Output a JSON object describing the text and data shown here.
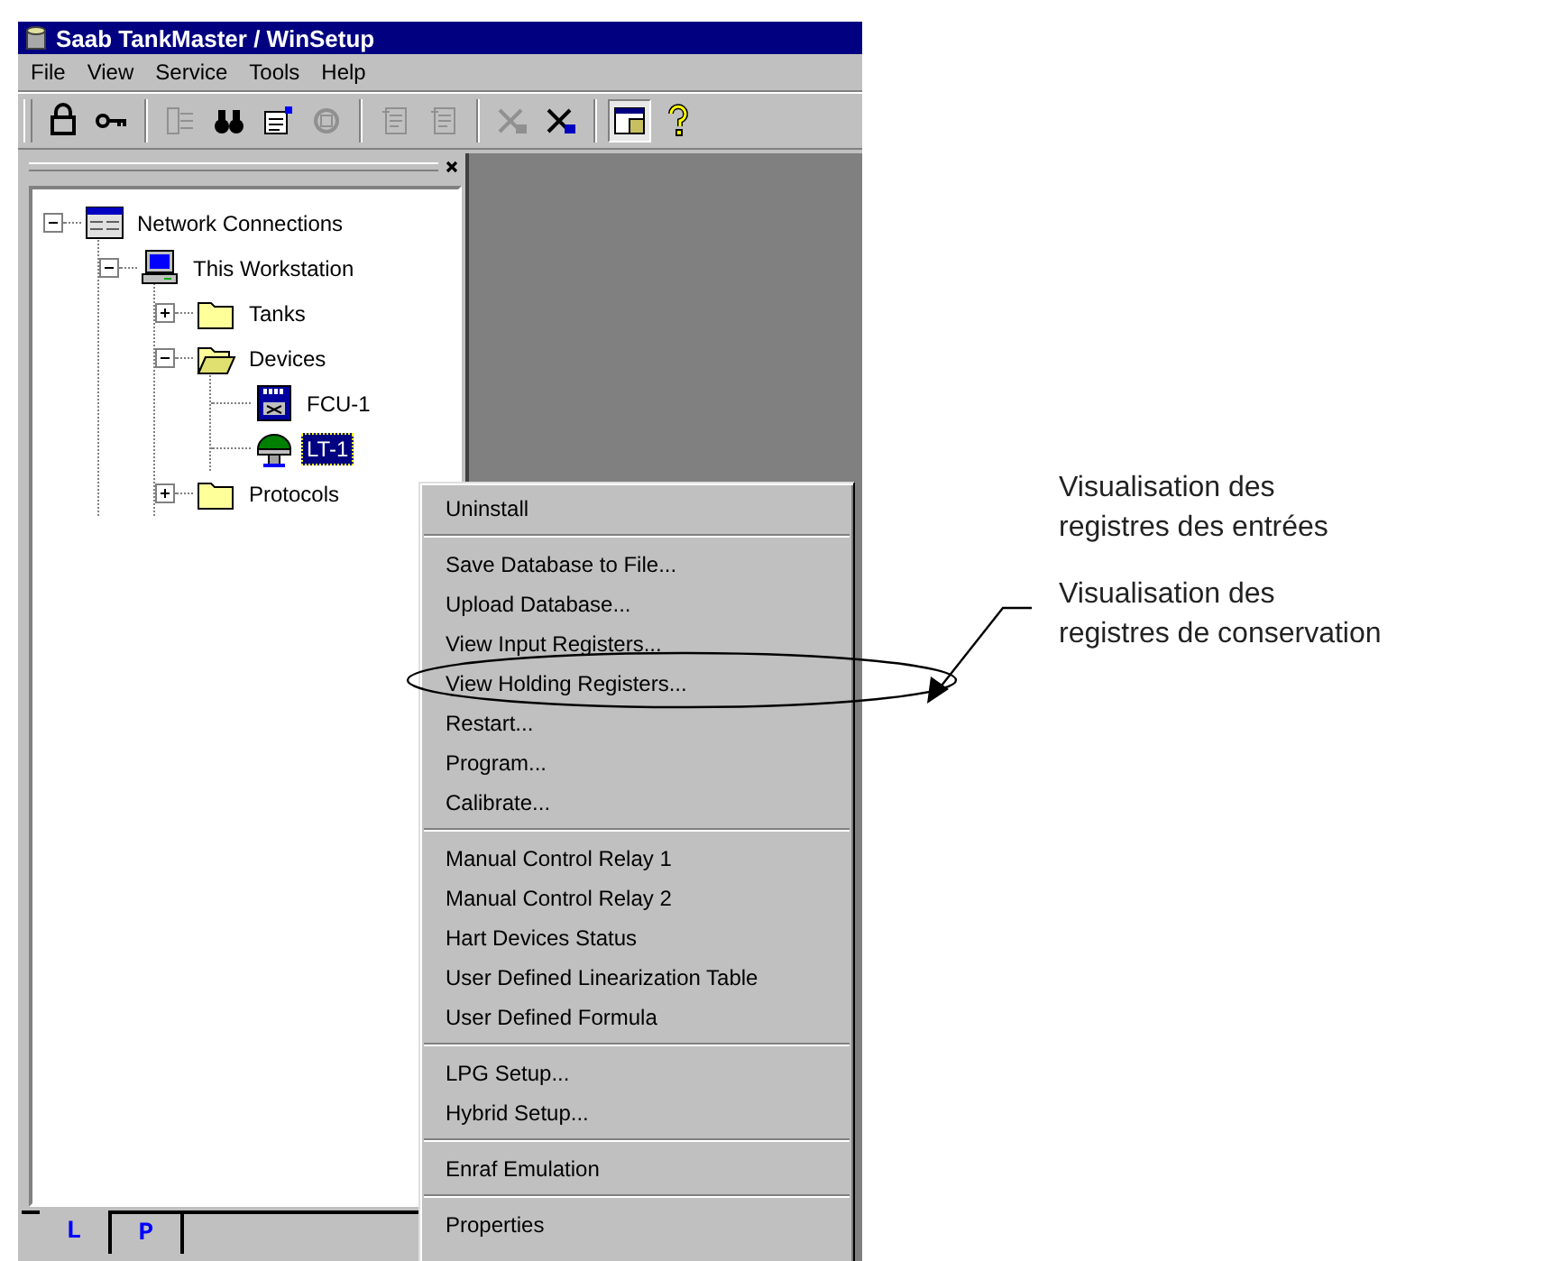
{
  "window": {
    "title": "Saab TankMaster / WinSetup"
  },
  "menu_bar": [
    "File",
    "View",
    "Service",
    "Tools",
    "Help"
  ],
  "toolbar": [
    {
      "kind": "grip"
    },
    {
      "kind": "lock",
      "disabled": false
    },
    {
      "kind": "key",
      "disabled": false
    },
    {
      "kind": "separator"
    },
    {
      "kind": "import",
      "disabled": true
    },
    {
      "kind": "binoculars",
      "disabled": false
    },
    {
      "kind": "properties",
      "disabled": false
    },
    {
      "kind": "device",
      "disabled": true
    },
    {
      "kind": "separator"
    },
    {
      "kind": "doc",
      "disabled": true
    },
    {
      "kind": "doc",
      "disabled": true
    },
    {
      "kind": "separator"
    },
    {
      "kind": "cut",
      "disabled": true
    },
    {
      "kind": "cut",
      "disabled": false
    },
    {
      "kind": "separator"
    },
    {
      "kind": "window",
      "disabled": false,
      "pressed": true
    },
    {
      "kind": "help",
      "disabled": false
    }
  ],
  "tree": [
    {
      "label": "Network Connections",
      "kind": "network",
      "selected": false,
      "expanded": true,
      "children": [
        {
          "label": "This Workstation",
          "kind": "workstation",
          "selected": false,
          "expanded": true,
          "children": [
            {
              "label": "Tanks",
              "kind": "folder",
              "selected": false,
              "expanded": false
            },
            {
              "label": "Devices",
              "kind": "folder",
              "selected": false,
              "expanded": true,
              "children": [
                {
                  "label": "FCU-1",
                  "kind": "fcu",
                  "selected": false
                },
                {
                  "label": "LT-1",
                  "kind": "gauge",
                  "selected": true
                }
              ]
            },
            {
              "label": "Protocols",
              "kind": "folder",
              "selected": false,
              "expanded": false
            }
          ]
        }
      ]
    }
  ],
  "panel_tabs": [
    {
      "label": "L",
      "selected": true
    },
    {
      "label": "P",
      "selected": false
    }
  ],
  "context_menu": [
    {
      "kind": "item",
      "label": "Uninstall"
    },
    {
      "kind": "separator"
    },
    {
      "kind": "item",
      "label": "Save Database to File..."
    },
    {
      "kind": "item",
      "label": "Upload Database..."
    },
    {
      "kind": "item",
      "label": "View Input Registers..."
    },
    {
      "kind": "item",
      "label": "View Holding Registers..."
    },
    {
      "kind": "item",
      "label": "Restart..."
    },
    {
      "kind": "item",
      "label": "Program..."
    },
    {
      "kind": "item",
      "label": "Calibrate..."
    },
    {
      "kind": "separator"
    },
    {
      "kind": "item",
      "label": "Manual Control Relay 1"
    },
    {
      "kind": "item",
      "label": "Manual Control Relay 2"
    },
    {
      "kind": "item",
      "label": "Hart Devices Status"
    },
    {
      "kind": "item",
      "label": "User Defined Linearization Table"
    },
    {
      "kind": "item",
      "label": "User Defined Formula"
    },
    {
      "kind": "separator"
    },
    {
      "kind": "item",
      "label": "LPG Setup..."
    },
    {
      "kind": "item",
      "label": "Hybrid Setup..."
    },
    {
      "kind": "separator"
    },
    {
      "kind": "item",
      "label": "Enraf Emulation"
    },
    {
      "kind": "separator"
    },
    {
      "kind": "item",
      "label": "Properties"
    }
  ],
  "annotations": [
    {
      "lines": [
        "Visualisation des",
        "registres des entrées"
      ]
    },
    {
      "lines": [
        "Visualisation des",
        "registres de conservation"
      ],
      "pointer": true
    }
  ]
}
